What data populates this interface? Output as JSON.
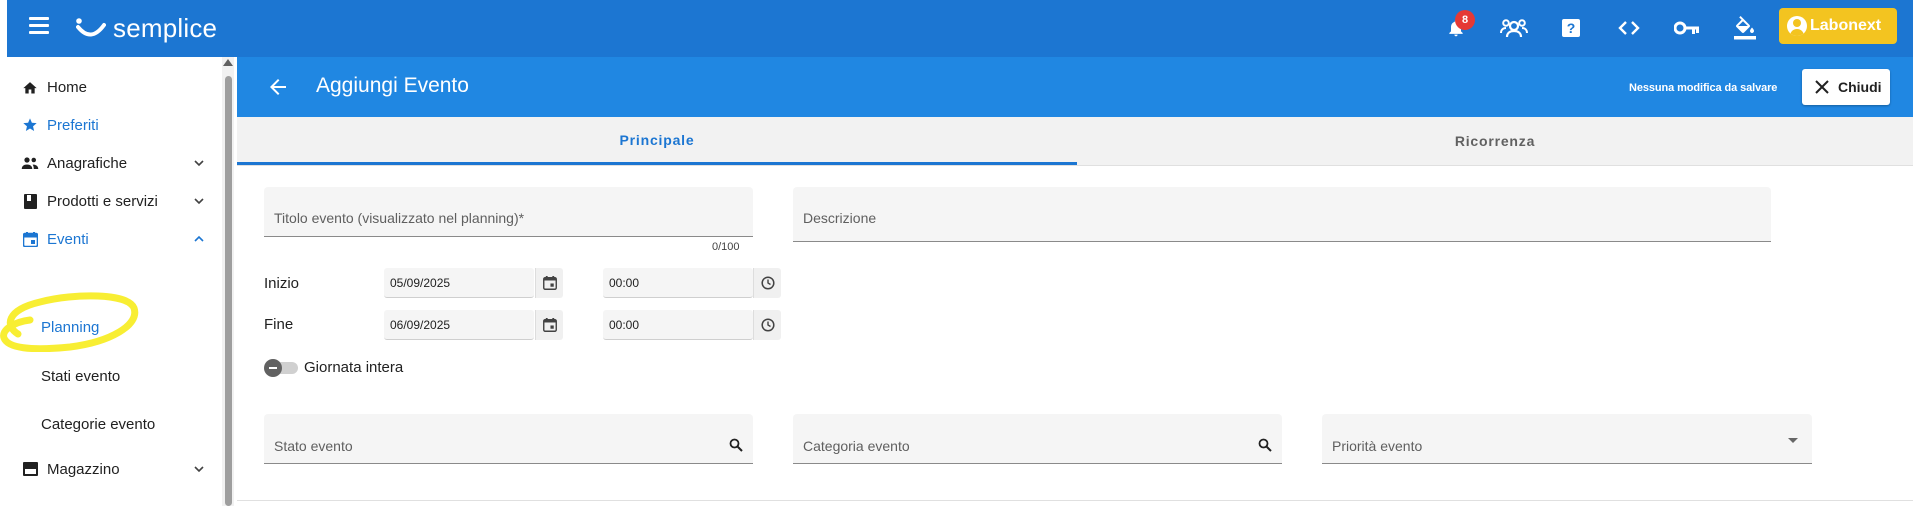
{
  "app": {
    "brand": "semplice",
    "notifications_count": "8",
    "user_label": "Labonext",
    "colors": {
      "primary": "#1c76d2",
      "header": "#2087e2",
      "accent": "#f3c420",
      "badge": "#e53935"
    }
  },
  "topbar": {
    "icons": [
      "menu-icon",
      "bell-icon",
      "support-group-icon",
      "help-icon",
      "code-icon",
      "key-icon",
      "paint-bucket-icon",
      "user-account-icon"
    ]
  },
  "sidebar": {
    "items": [
      {
        "label": "Home",
        "icon": "home-icon"
      },
      {
        "label": "Preferiti",
        "icon": "star-icon"
      },
      {
        "label": "Anagrafiche",
        "icon": "people-icon"
      },
      {
        "label": "Prodotti e servizi",
        "icon": "book-icon"
      },
      {
        "label": "Eventi",
        "icon": "calendar-icon"
      },
      {
        "label": "Magazzino",
        "icon": "warehouse-icon"
      }
    ],
    "sub_items": [
      {
        "label": "Planning"
      },
      {
        "label": "Stati evento"
      },
      {
        "label": "Categorie evento"
      }
    ]
  },
  "header": {
    "title": "Aggiungi Evento",
    "status": "Nessuna modifica da salvare",
    "close_label": "Chiudi"
  },
  "tabs": [
    {
      "label": "Principale",
      "active": true
    },
    {
      "label": "Ricorrenza",
      "active": false
    }
  ],
  "form": {
    "title_label": "Titolo evento (visualizzato nel planning)*",
    "title_counter": "0/100",
    "description_label": "Descrizione",
    "start_label": "Inizio",
    "start_date": "05/09/2025",
    "start_time": "00:00",
    "end_label": "Fine",
    "end_date": "06/09/2025",
    "end_time": "00:00",
    "all_day_label": "Giornata intera",
    "status_label": "Stato evento",
    "category_label": "Categoria evento",
    "priority_label": "Priorità evento"
  }
}
